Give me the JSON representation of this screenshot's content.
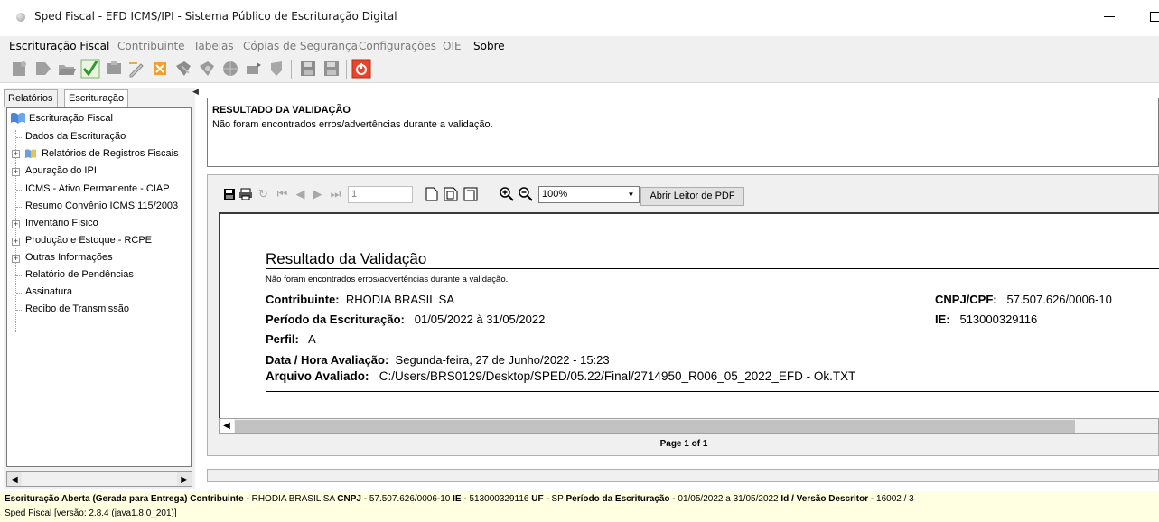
{
  "window": {
    "title": "Sped Fiscal - EFD ICMS/IPI - Sistema Público de Escrituração Digital"
  },
  "menu": [
    {
      "label": "Escrituração Fiscal",
      "active": true
    },
    {
      "label": "Contribuinte",
      "active": false
    },
    {
      "label": "Tabelas",
      "active": false
    },
    {
      "label": "Cópias de Segurança",
      "active": false
    },
    {
      "label": "Configurações",
      "active": false
    },
    {
      "label": "OIE",
      "active": false
    },
    {
      "label": "Sobre",
      "active": true
    }
  ],
  "toolbar_icons": [
    "new-file-icon",
    "import-icon",
    "open-folder-icon",
    "validate-check-icon",
    "sign-icon",
    "edit-icon",
    "close-icon",
    "print-icon",
    "print-preview-icon",
    "globe-icon",
    "transmit-icon",
    "shield-icon",
    "save-icon",
    "save-as-icon",
    "power-icon"
  ],
  "left_panel": {
    "tabs": [
      "Relatórios",
      "Escrituração"
    ],
    "active_tab": "Escrituração",
    "tree_root": "Escrituração Fiscal",
    "tree_items": [
      {
        "label": "Dados da Escrituração",
        "expandable": false
      },
      {
        "label": "Relatórios de Registros Fiscais",
        "expandable": true
      },
      {
        "label": "Apuração do IPI",
        "expandable": true
      },
      {
        "label": "ICMS - Ativo Permanente - CIAP",
        "expandable": false
      },
      {
        "label": "Resumo  Convênio ICMS 115/2003",
        "expandable": false
      },
      {
        "label": "Inventário Físico",
        "expandable": true
      },
      {
        "label": "Produção e Estoque - RCPE",
        "expandable": true
      },
      {
        "label": "Outras Informações",
        "expandable": true
      },
      {
        "label": "Relatório de Pendências",
        "expandable": false
      },
      {
        "label": "Assinatura",
        "expandable": false
      },
      {
        "label": "Recibo de Transmissão",
        "expandable": false
      }
    ]
  },
  "result": {
    "title": "RESULTADO DA VALIDAÇÃO",
    "message": "Não foram encontrados erros/advertências durante a validação."
  },
  "viewer": {
    "page_value": "1",
    "zoom": "100%",
    "open_pdf_label": "Abrir Leitor de PDF",
    "page_label": "Page 1 of 1"
  },
  "report": {
    "title": "Resultado da Validação",
    "subtitle": "Não foram encontrados erros/advertências durante a validação.",
    "contribuinte_label": "Contribuinte:",
    "contribuinte": "RHODIA BRASIL SA",
    "cnpj_label": "CNPJ/CPF:",
    "cnpj": "57.507.626/0006-10",
    "periodo_label": "Período da Escrituração:",
    "periodo": "01/05/2022 à 31/05/2022",
    "ie_label": "IE:",
    "ie": "513000329116",
    "perfil_label": "Perfil:",
    "perfil": "A",
    "data_label": "Data / Hora Avaliação:",
    "data": "Segunda-feira, 27 de Junho/2022 - 15:23",
    "arquivo_label": "Arquivo Avaliado:",
    "arquivo": "C:/Users/BRS0129/Desktop/SPED/05.22/Final/2714950_R006_05_2022_EFD - Ok.TXT"
  },
  "status": {
    "status_label": "Escrituração Aberta (Gerada para Entrega)",
    "contribuinte_label": "Contribuinte",
    "contribuinte": "RHODIA BRASIL SA",
    "cnpj_label": "CNPJ",
    "cnpj": "57.507.626/0006-10",
    "ie_label": "IE",
    "ie": "513000329116",
    "uf_label": "UF",
    "uf": "SP",
    "periodo_label": "Período da Escrituração",
    "periodo": "01/05/2022 a 31/05/2022",
    "versao_label": "Id / Versão Descritor",
    "versao": "16002 / 3",
    "app_version": "Sped Fiscal [versão: 2.8.4 (java1.8.0_201)]"
  }
}
